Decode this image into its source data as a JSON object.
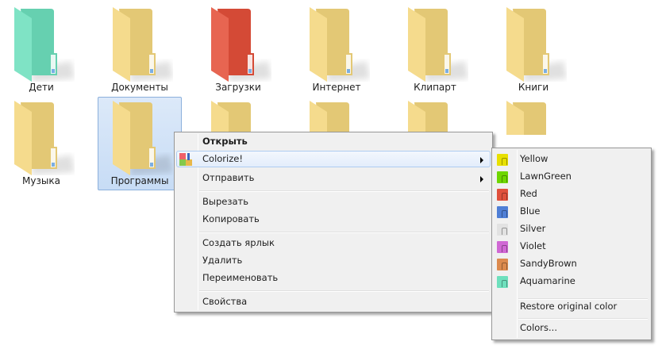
{
  "folders": [
    {
      "label": "Дети",
      "color": "#6ee0bd"
    },
    {
      "label": "Документы",
      "color": "#f4d77e"
    },
    {
      "label": "Загрузки",
      "color": "#e4503a"
    },
    {
      "label": "Интернет",
      "color": "#f4d77e"
    },
    {
      "label": "Клипарт",
      "color": "#f4d77e"
    },
    {
      "label": "Книги",
      "color": "#f4d77e"
    },
    {
      "label": "Музыка",
      "color": "#f4d77e"
    },
    {
      "label": "Программы",
      "color": "#f4d77e",
      "selected": true
    },
    {
      "label": null,
      "color": "#f4d77e"
    },
    {
      "label": null,
      "color": "#f4d77e"
    },
    {
      "label": null,
      "color": "#f4d77e"
    },
    {
      "label": null,
      "color": "#f4d77e"
    }
  ],
  "context_menu": {
    "open": "Открыть",
    "colorize": "Colorize!",
    "send_to": "Отправить",
    "cut": "Вырезать",
    "copy": "Копировать",
    "shortcut": "Создать ярлык",
    "delete": "Удалить",
    "rename": "Переименовать",
    "properties": "Свойства"
  },
  "colorize_submenu": {
    "colors": [
      {
        "label": "Yellow",
        "color": "#e8e000"
      },
      {
        "label": "LawnGreen",
        "color": "#6fd600"
      },
      {
        "label": "Red",
        "color": "#e0503c"
      },
      {
        "label": "Blue",
        "color": "#4f7fd6"
      },
      {
        "label": "Silver",
        "color": "#e2e2e2"
      },
      {
        "label": "Violet",
        "color": "#d068d4"
      },
      {
        "label": "SandyBrown",
        "color": "#dc8a4e"
      },
      {
        "label": "Aquamarine",
        "color": "#6ee0bd"
      }
    ],
    "restore": "Restore original color",
    "more": "Colors..."
  }
}
